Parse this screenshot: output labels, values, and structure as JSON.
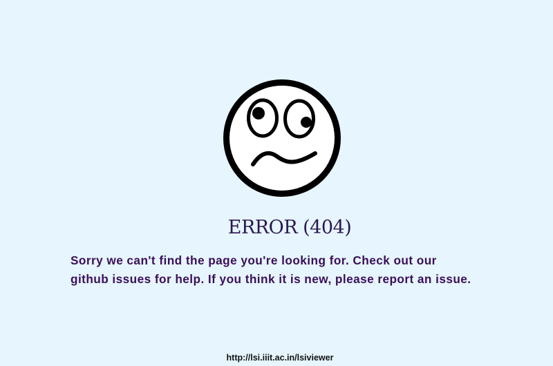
{
  "error": {
    "icon": "confused-face-icon",
    "title": "ERROR (404)"
  },
  "message": {
    "line1": "Sorry we can't find the page you're looking for. Check out our",
    "github_issues_link": "github issues",
    "middle": " for help. If you think it is new, please ",
    "report_issue_link": "report an issue",
    "end": "."
  },
  "footer": {
    "link": "http://lsi.iiit.ac.in/lsiviewer"
  },
  "colors": {
    "background": "#e6f5fe",
    "title": "#2a174f",
    "message": "#3a0f57"
  }
}
